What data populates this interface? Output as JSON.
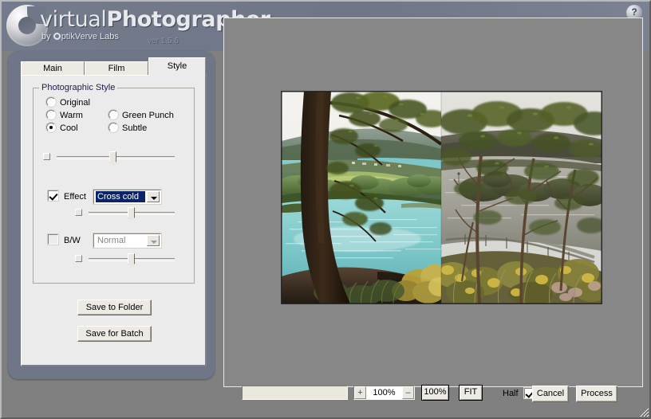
{
  "app": {
    "brand_virtual": "virtual",
    "brand_photographer": "Photographer",
    "byline_prefix": "by ",
    "byline_optik": "ptikVerve Labs",
    "version": "ver 1.5.6",
    "help_label": "?",
    "help_icon": "question-mark-icon"
  },
  "tabs": [
    {
      "label": "Main",
      "active": false
    },
    {
      "label": "Film",
      "active": false
    },
    {
      "label": "Style",
      "active": true
    }
  ],
  "style_group": {
    "title": "Photographic Style",
    "radios": [
      {
        "label": "Original",
        "selected": false
      },
      {
        "label": "Warm",
        "selected": false
      },
      {
        "label": "Cool",
        "selected": true
      },
      {
        "label": "Green Punch",
        "selected": false
      },
      {
        "label": "Subtle",
        "selected": false
      }
    ],
    "style_slider": {
      "value_pct": 55,
      "nub_label": ""
    },
    "effect": {
      "label": "Effect",
      "checked": true,
      "value": "Cross cold",
      "enabled": true,
      "slider_pct": 56
    },
    "bw": {
      "label": "B/W",
      "checked": false,
      "value": "Normal",
      "enabled": false,
      "slider_pct": 56
    }
  },
  "actions": {
    "save_to_folder": "Save to Folder",
    "save_for_batch": "Save for Batch"
  },
  "bottom_bar": {
    "progress_value": "",
    "zoom_plus": "+",
    "zoom_minus": "–",
    "zoom_value": "100%",
    "zoom_100_label": "100%",
    "fit_label": "FIT",
    "half_label": "Half",
    "half_checked": true,
    "cancel_label": "Cancel",
    "process_label": "Process"
  },
  "preview": {
    "description": "Split preview of a lakeside landscape seen through eucalyptus trees; left half shows the cool-processed result, right half shows the warm original.",
    "split_pct": 50
  },
  "colors": {
    "header": "#6f7789",
    "panel_face": "#ebebeb",
    "button_face": "#eceae2",
    "canvas": "#878787",
    "window_bg": "#808080",
    "selection": "#0a246a"
  }
}
